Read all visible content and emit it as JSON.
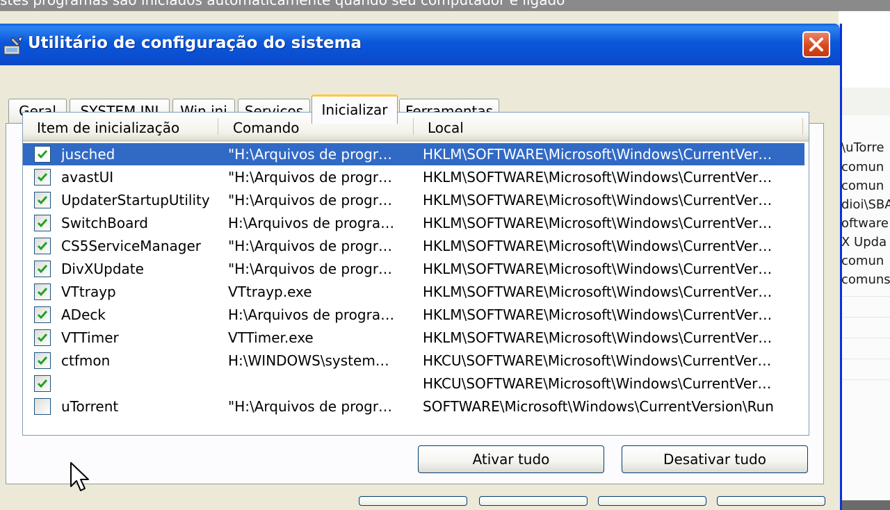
{
  "background_window": {
    "header_text": "stes programas são iniciados automaticamente quando seu computador é ligado",
    "right_list": [
      "\\uTorre",
      "comun",
      "comun",
      "dioi\\SBA",
      "oftware",
      "X Upda",
      "comun",
      "comuns"
    ]
  },
  "dialog": {
    "title": "Utilitário de configuração do sistema",
    "close_icon": "close-x-icon",
    "title_icon": "system-config-icon"
  },
  "tabs": [
    {
      "label": "Geral"
    },
    {
      "label": "SYSTEM.INI"
    },
    {
      "label": "Win.ini"
    },
    {
      "label": "Serviços"
    },
    {
      "label": "Inicializar",
      "active": true
    },
    {
      "label": "Ferramentas"
    }
  ],
  "list": {
    "columns": [
      "Item de inicialização",
      "Comando",
      "Local"
    ],
    "rows": [
      {
        "checked": true,
        "item": "jusched",
        "command": "\"H:\\Arquivos de progr…",
        "location": "HKLM\\SOFTWARE\\Microsoft\\Windows\\CurrentVer…",
        "selected": true
      },
      {
        "checked": true,
        "item": "avastUI",
        "command": "\"H:\\Arquivos de progr…",
        "location": "HKLM\\SOFTWARE\\Microsoft\\Windows\\CurrentVer…"
      },
      {
        "checked": true,
        "item": "UpdaterStartupUtility",
        "command": "\"H:\\Arquivos de progr…",
        "location": "HKLM\\SOFTWARE\\Microsoft\\Windows\\CurrentVer…"
      },
      {
        "checked": true,
        "item": "SwitchBoard",
        "command": "H:\\Arquivos de progra…",
        "location": "HKLM\\SOFTWARE\\Microsoft\\Windows\\CurrentVer…"
      },
      {
        "checked": true,
        "item": "CS5ServiceManager",
        "command": "\"H:\\Arquivos de progr…",
        "location": "HKLM\\SOFTWARE\\Microsoft\\Windows\\CurrentVer…"
      },
      {
        "checked": true,
        "item": "DivXUpdate",
        "command": "\"H:\\Arquivos de progr…",
        "location": "HKLM\\SOFTWARE\\Microsoft\\Windows\\CurrentVer…"
      },
      {
        "checked": true,
        "item": "VTtrayp",
        "command": "VTtrayp.exe",
        "location": "HKLM\\SOFTWARE\\Microsoft\\Windows\\CurrentVer…"
      },
      {
        "checked": true,
        "item": "ADeck",
        "command": "H:\\Arquivos de progra…",
        "location": "HKLM\\SOFTWARE\\Microsoft\\Windows\\CurrentVer…"
      },
      {
        "checked": true,
        "item": "VTTimer",
        "command": "VTTimer.exe",
        "location": "HKLM\\SOFTWARE\\Microsoft\\Windows\\CurrentVer…"
      },
      {
        "checked": true,
        "item": "ctfmon",
        "command": "H:\\WINDOWS\\system…",
        "location": "HKCU\\SOFTWARE\\Microsoft\\Windows\\CurrentVer…"
      },
      {
        "checked": true,
        "item": "",
        "command": "",
        "location": "HKCU\\SOFTWARE\\Microsoft\\Windows\\CurrentVer…"
      },
      {
        "checked": false,
        "item": "uTorrent",
        "command": "\"H:\\Arquivos de progr…",
        "location": "SOFTWARE\\Microsoft\\Windows\\CurrentVersion\\Run"
      }
    ]
  },
  "buttons": {
    "enable_all": "Ativar tudo",
    "disable_all": "Desativar tudo"
  },
  "colors": {
    "titlebar": "#0a4ed1",
    "selection": "#316ac5",
    "check": "#21a121",
    "active_tab_accent": "#ffc83c"
  }
}
